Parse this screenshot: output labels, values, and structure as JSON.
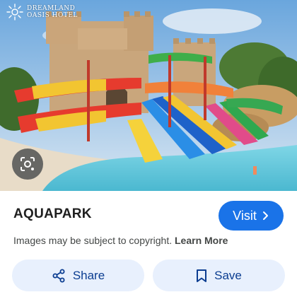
{
  "hotel_logo": {
    "line1": "DREAMLAND",
    "line2": "OASIS HOTEL"
  },
  "result": {
    "title": "AQUAPARK"
  },
  "visit_button": {
    "label": "Visit"
  },
  "copyright": {
    "text": "Images may be subject to copyright.",
    "link": "Learn More"
  },
  "actions": {
    "share_label": "Share",
    "save_label": "Save"
  },
  "icons": {
    "lens": "lens-icon",
    "visit": "chevron-right-icon",
    "share": "share-icon",
    "save": "bookmark-icon",
    "logo": "sun-logo-icon"
  },
  "colors": {
    "accent": "#1a73e8",
    "action_bg": "#e8f0fd",
    "action_text": "#0b3d91"
  }
}
